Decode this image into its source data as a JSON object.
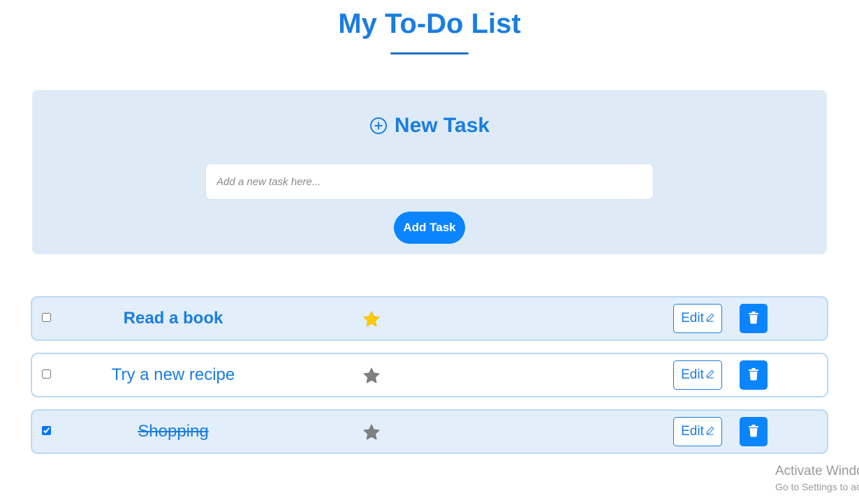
{
  "header": {
    "title": "My To-Do List"
  },
  "new_task": {
    "heading": "New Task",
    "heading_icon": "plus-circle-icon",
    "input_placeholder": "Add a new task here...",
    "input_value": "",
    "add_button_label": "Add Task"
  },
  "tasks": [
    {
      "name": "Read a book",
      "completed": false,
      "starred": true
    },
    {
      "name": "Try a new recipe",
      "completed": false,
      "starred": false
    },
    {
      "name": "Shopping",
      "completed": true,
      "starred": false
    }
  ],
  "row_actions": {
    "edit_label": "Edit",
    "edit_icon": "pencil-icon",
    "delete_icon": "trash-icon",
    "star_icon": "star-icon"
  },
  "watermark": {
    "line1": "Activate Windows",
    "line2": "Go to Settings to activate Windows."
  },
  "colors": {
    "accent": "#1a7de0",
    "button_blue": "#0a84ff",
    "panel_bg": "#deebf7",
    "row_border": "#bad9f5",
    "star_active": "#ffcc00",
    "star_inactive": "#808080"
  }
}
